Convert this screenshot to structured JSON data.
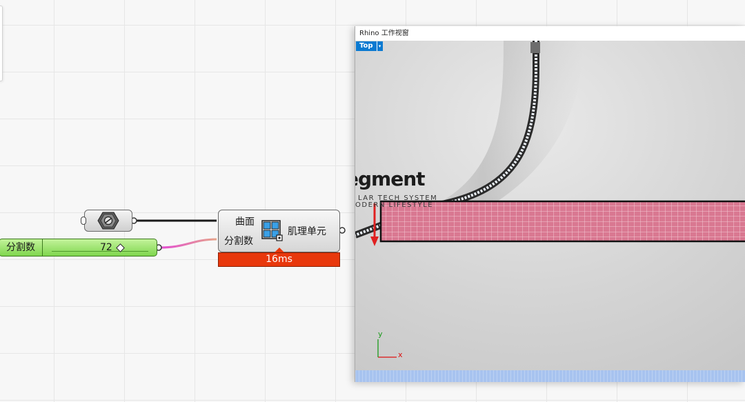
{
  "canvas": {
    "geometry_param": {
      "icon": "hex-nut-geometry-icon"
    },
    "slider": {
      "label": "分割数",
      "value": "72"
    },
    "component": {
      "inputs": [
        "曲面",
        "分割数"
      ],
      "output": "肌理单元",
      "icon": "grid-panel-icon",
      "timer": "16ms"
    },
    "wire_colors": {
      "geometry": "#1a1a1a",
      "slider_start": "#e34bd3",
      "slider_end": "#e6a58a"
    }
  },
  "rhino": {
    "window_title": "Rhino 工作视窗",
    "view": {
      "label": "Top",
      "dropdown_glyph": "▾"
    },
    "scene": {
      "brand": "egment",
      "tagline_1": "LAR TECH SYSTEM",
      "tagline_2": "ODERN LIFESTYLE",
      "panel_color": "#d97891",
      "grid_line_color": "#f3c9d3"
    },
    "axes": {
      "x": "x",
      "y": "y"
    }
  }
}
